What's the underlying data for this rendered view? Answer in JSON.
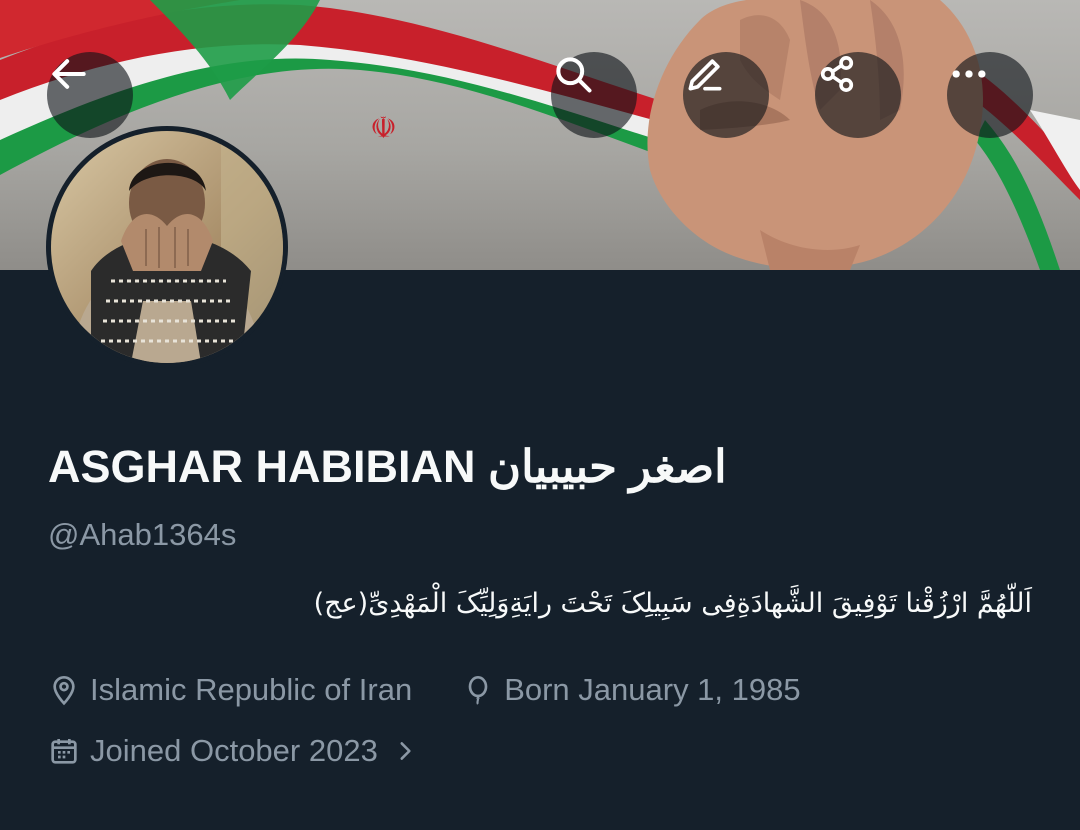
{
  "header": {
    "back_icon": "arrow-left-icon",
    "actions": [
      {
        "icon": "search-icon"
      },
      {
        "icon": "edit-icon"
      },
      {
        "icon": "share-icon"
      },
      {
        "icon": "more-icon"
      }
    ]
  },
  "profile": {
    "display_name": "ASGHAR HABIBIAN اصغر حبیبیان",
    "handle": "@Ahab1364s",
    "bio": "اَللّهُمَّ ارْزُقْنا تَوْفِیقَ الشَّهادَةِفِی سَبِیلِکَ تَحْتَ رایَةِوَلِیِّکَ الْمَهْدِیِّ(عج)",
    "location": "Islamic Republic of Iran",
    "birthday": "Born January 1, 1985",
    "joined": "Joined October 2023"
  },
  "colors": {
    "background": "#15202b",
    "text_primary": "#f7f9f9",
    "text_secondary": "#8b98a5"
  }
}
